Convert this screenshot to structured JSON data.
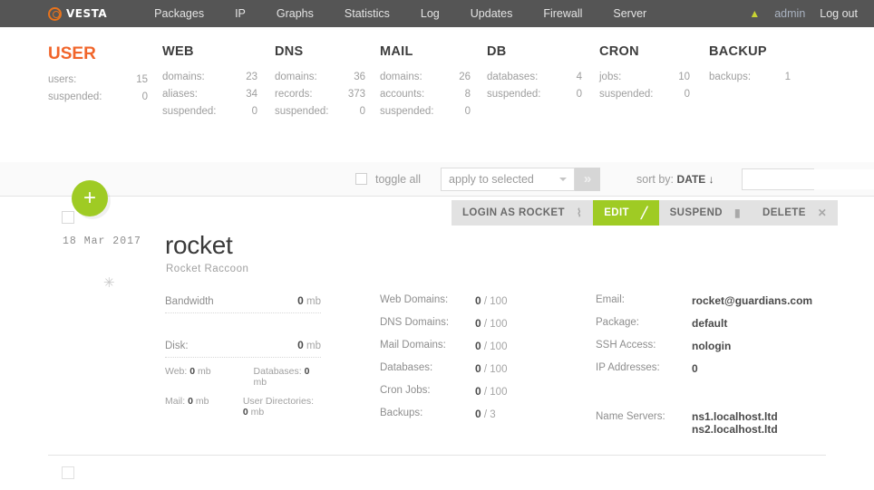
{
  "nav": {
    "brand": "VESTA",
    "brand_icon": "gear-circle-icon",
    "items": [
      {
        "label": "Packages"
      },
      {
        "label": "IP"
      },
      {
        "label": "Graphs"
      },
      {
        "label": "Statistics"
      },
      {
        "label": "Log"
      },
      {
        "label": "Updates"
      },
      {
        "label": "Firewall"
      },
      {
        "label": "Server"
      }
    ],
    "bell_icon": "notification-bell-icon",
    "bell_glyph": "▲",
    "user": "admin",
    "logout": "Log out"
  },
  "stats": {
    "groups": [
      {
        "title": "USER",
        "active": true,
        "rows": [
          {
            "label": "users:",
            "value": "15"
          },
          {
            "label": "suspended:",
            "value": "0"
          }
        ]
      },
      {
        "title": "WEB",
        "active": false,
        "rows": [
          {
            "label": "domains:",
            "value": "23"
          },
          {
            "label": "aliases:",
            "value": "34"
          },
          {
            "label": "suspended:",
            "value": "0"
          }
        ]
      },
      {
        "title": "DNS",
        "active": false,
        "rows": [
          {
            "label": "domains:",
            "value": "36"
          },
          {
            "label": "records:",
            "value": "373"
          },
          {
            "label": "suspended:",
            "value": "0"
          }
        ]
      },
      {
        "title": "MAIL",
        "active": false,
        "rows": [
          {
            "label": "domains:",
            "value": "26"
          },
          {
            "label": "accounts:",
            "value": "8"
          },
          {
            "label": "suspended:",
            "value": "0"
          }
        ]
      },
      {
        "title": "DB",
        "active": false,
        "rows": [
          {
            "label": "databases:",
            "value": "4"
          },
          {
            "label": "suspended:",
            "value": "0"
          }
        ]
      },
      {
        "title": "CRON",
        "active": false,
        "rows": [
          {
            "label": "jobs:",
            "value": "10"
          },
          {
            "label": "suspended:",
            "value": "0"
          }
        ]
      },
      {
        "title": "BACKUP",
        "active": false,
        "rows": [
          {
            "label": "backups:",
            "value": "1"
          }
        ]
      }
    ]
  },
  "toolbar": {
    "toggle_all_label": "toggle all",
    "apply_selected_label": "apply to selected",
    "go_icon": "chevron-right-icon",
    "go_glyph": "»",
    "sort_prefix": "sort by:",
    "sort_value": "DATE ↓",
    "search_value": "",
    "search_placeholder": "",
    "search_icon": "magnifier-icon",
    "add_button_glyph": "+",
    "add_button_label": "add-user"
  },
  "record": {
    "date": "18 Mar 2017",
    "star_icon": "star-icon",
    "star_glyph": "✳",
    "name": "rocket",
    "fullname": "Rocket Raccoon",
    "actions": [
      {
        "label": "LOGIN AS ROCKET",
        "icon": "key-icon",
        "glyph": "⌇",
        "style": "gray"
      },
      {
        "label": "EDIT",
        "icon": "pencil-icon",
        "glyph": "╱",
        "style": "green"
      },
      {
        "label": "SUSPEND",
        "icon": "lock-icon",
        "glyph": "▮",
        "style": "gray"
      },
      {
        "label": "DELETE",
        "icon": "close-x-icon",
        "glyph": "✕",
        "style": "gray"
      }
    ],
    "usage": {
      "bandwidth_label": "Bandwidth",
      "bandwidth_value": "0",
      "bandwidth_unit": "mb",
      "disk_label": "Disk:",
      "disk_value": "0",
      "disk_unit": "mb",
      "web_label": "Web:",
      "web_value": "0",
      "web_unit": "mb",
      "databases_label": "Databases:",
      "databases_value": "0",
      "databases_unit": "mb",
      "mail_label": "Mail:",
      "mail_value": "0",
      "mail_unit": "mb",
      "userdirs_label": "User Directories:",
      "userdirs_value": "0",
      "userdirs_unit": "mb"
    },
    "quotas": [
      {
        "label": "Web Domains:",
        "used": "0",
        "limit": "/ 100"
      },
      {
        "label": "DNS Domains:",
        "used": "0",
        "limit": "/ 100"
      },
      {
        "label": "Mail Domains:",
        "used": "0",
        "limit": "/ 100"
      },
      {
        "label": "Databases:",
        "used": "0",
        "limit": "/ 100"
      },
      {
        "label": "Cron Jobs:",
        "used": "0",
        "limit": "/ 100"
      },
      {
        "label": "Backups:",
        "used": "0",
        "limit": "/ 3"
      }
    ],
    "details": [
      {
        "label": "Email:",
        "value": "rocket@guardians.com"
      },
      {
        "label": "Package:",
        "value": "default"
      },
      {
        "label": "SSH Access:",
        "value": "nologin"
      },
      {
        "label": "IP Addresses:",
        "value": "0"
      }
    ],
    "nameservers_label": "Name Servers:",
    "nameservers": [
      "ns1.localhost.ltd",
      "ns2.localhost.ltd"
    ]
  },
  "colors": {
    "nav_bg": "#555555",
    "accent_orange": "#f1652a",
    "accent_green": "#9fcb24",
    "brand_orange": "#e8731c"
  }
}
